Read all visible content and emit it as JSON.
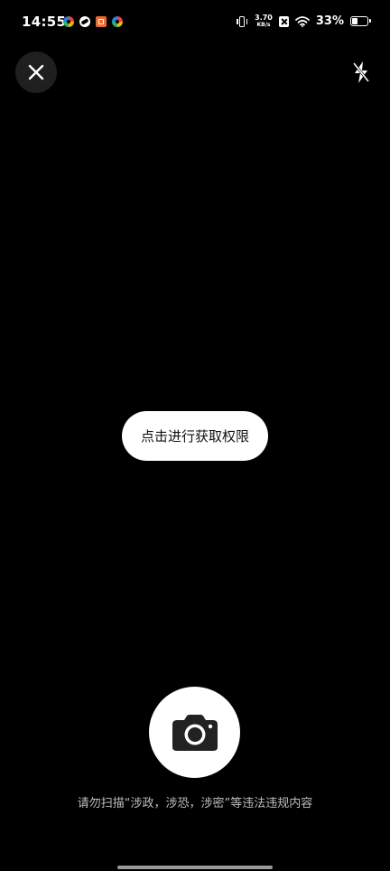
{
  "status_bar": {
    "time": "14:55",
    "net_speed_value": "3.70",
    "net_speed_unit": "KB/s",
    "battery_percent": "33%",
    "battery_level": 0.33
  },
  "icons": {
    "close": "close-icon",
    "flash": "flash-off-icon",
    "camera": "camera-icon"
  },
  "permission": {
    "label": "点击进行获取权限"
  },
  "notice": {
    "text": "请勿扫描“涉政，涉恐，涉密”等违法违规内容"
  },
  "colors": {
    "background": "#000000",
    "button_bg": "#ffffff",
    "close_bg": "#1f1f1f"
  }
}
